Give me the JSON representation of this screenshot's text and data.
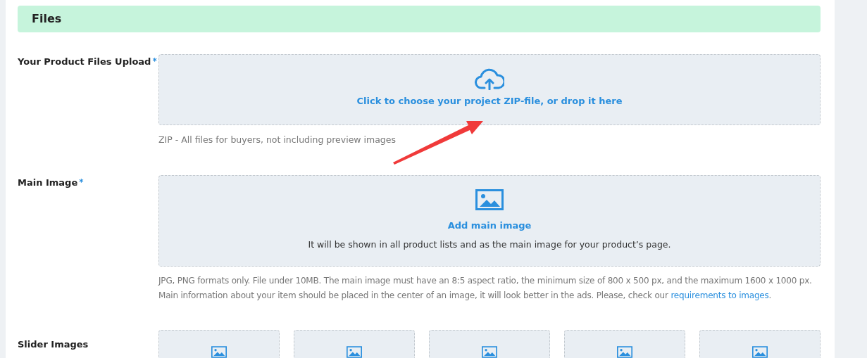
{
  "section_title": "Files",
  "fields": [
    {
      "kind": "file",
      "label": "Your Product Files Upload",
      "required_mark": "*",
      "action": "Click to choose your project ZIP-file, or drop it here",
      "hint": "ZIP - All files for buyers, not including preview images"
    },
    {
      "kind": "image",
      "label": "Main Image",
      "required_mark": "*",
      "action": "Add main image",
      "description": "It will be shown in all product lists and as the main image for your product’s page.",
      "hint": "JPG, PNG formats only. File under 10MB. The main image must have an 8:5 aspect ratio, the minimum size of 800 x 500 px, and the maximum 1600 x 1000 px. Main information about your item should be placed in the center of an image, it will look better in the ads. Please, check our ",
      "hint_link": "requirements to images",
      "hint_end": "."
    },
    {
      "kind": "slider",
      "label": "Slider Images",
      "slots": [
        {
          "kind": "image"
        },
        {
          "kind": "image"
        },
        {
          "kind": "image"
        },
        {
          "kind": "image"
        },
        {
          "kind": "image"
        }
      ]
    }
  ]
}
